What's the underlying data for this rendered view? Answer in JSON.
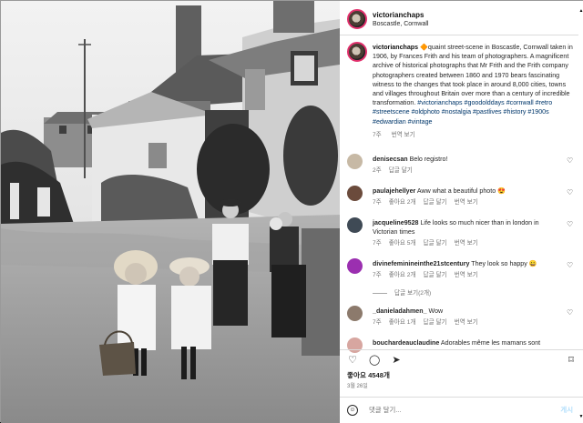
{
  "post": {
    "username": "victorianchaps",
    "location": "Boscastle, Cornwall",
    "caption_prefix": "🔶",
    "caption_text": "quaint street-scene in Boscastle, Cornwall taken in 1906, by Frances Frith and his team of photographers. A magnificent archive of historical photographs that Mr Frith and the Frith company photographers created between 1860 and 1970 bears fascinating witness to the changes that took place in around 8,000 cities, towns and villages throughout Britain over more than a century of incredible transformation.",
    "hashtags": "#victorianchaps #goodolddays #cornwall #retro #streetscene #oldphoto #nostalgia #pastlives #history #1900s #edwardian #vintage",
    "caption_age": "7주",
    "caption_translate": "번역 보기"
  },
  "comments": [
    {
      "user": "denisecsan",
      "text": "Belo registro!",
      "age": "2주",
      "likes": "",
      "reply": "답글 달기",
      "translate": "",
      "avatar_color": "#c7b9a5"
    },
    {
      "user": "paulajehellyer",
      "text": "Aww what a beautiful photo 😍",
      "age": "7주",
      "likes": "좋아요 2개",
      "reply": "답글 달기",
      "translate": "번역 보기",
      "avatar_color": "#6b4b3c"
    },
    {
      "user": "jacqueline9528",
      "text": "Life looks so much nicer than in london in Victorian times",
      "age": "7주",
      "likes": "좋아요 5개",
      "reply": "답글 달기",
      "translate": "번역 보기",
      "avatar_color": "#3f4a55"
    },
    {
      "user": "divinefeminineinthe21stcentury",
      "text": "They look so happy 😀",
      "age": "7주",
      "likes": "좋아요 2개",
      "reply": "답글 달기",
      "translate": "번역 보기",
      "avatar_color": "#9b2fb0"
    },
    {
      "user": "_danieladahmen_",
      "text": "Wow",
      "age": "7주",
      "likes": "좋아요 1개",
      "reply": "답글 달기",
      "translate": "번역 보기",
      "avatar_color": "#8c7a6c"
    },
    {
      "user": "bouchardeauclaudine",
      "text": "Adorables même les mamans sont",
      "age": "",
      "likes": "",
      "reply": "",
      "translate": "",
      "avatar_color": "#d7a6a0"
    }
  ],
  "replies_label": "답글 보기(2개)",
  "actions": {
    "like_icon": "heart-icon",
    "comment_icon": "comment-icon",
    "share_icon": "share-icon",
    "save_icon": "bookmark-icon"
  },
  "likes_text": "좋아요 4548개",
  "date_text": "3월 26일",
  "add_comment_placeholder": "댓글 달기...",
  "post_button": "게시"
}
